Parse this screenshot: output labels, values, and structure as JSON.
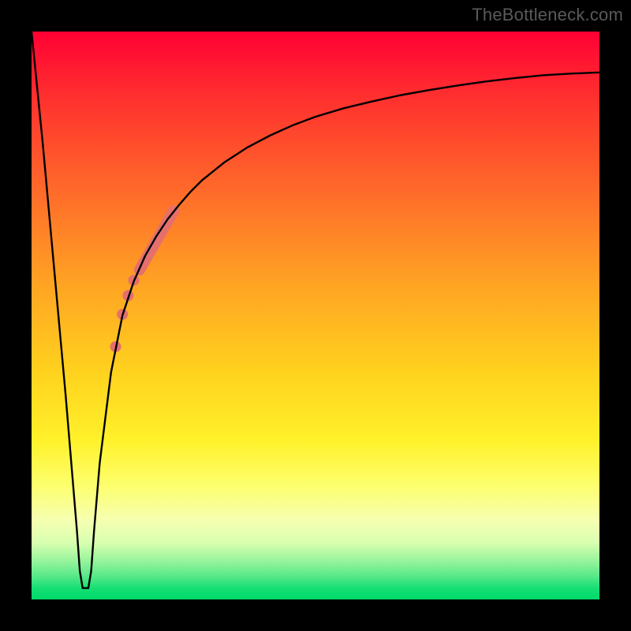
{
  "attribution": "TheBottleneck.com",
  "chart_data": {
    "type": "line",
    "title": "",
    "xlabel": "",
    "ylabel": "",
    "xlim": [
      0,
      100
    ],
    "ylim": [
      0,
      100
    ],
    "grid": false,
    "legend": false,
    "series": [
      {
        "name": "bottleneck-curve",
        "x": [
          0,
          2,
          4,
          6,
          8,
          8.5,
          9,
          9.5,
          10,
          10.5,
          11,
          12,
          14,
          16,
          18,
          20,
          22,
          24,
          26,
          28,
          30,
          34,
          38,
          42,
          46,
          50,
          55,
          60,
          65,
          70,
          75,
          80,
          85,
          90,
          95,
          100
        ],
        "y": [
          100,
          80,
          58,
          36,
          12,
          5,
          2,
          2,
          2,
          5,
          12,
          24,
          40,
          50,
          56,
          60.5,
          64,
          67,
          69.5,
          71.8,
          73.8,
          77,
          79.6,
          81.7,
          83.5,
          85.0,
          86.5,
          87.7,
          88.8,
          89.7,
          90.5,
          91.2,
          91.8,
          92.3,
          92.6,
          92.8
        ],
        "color": "#000000",
        "width": 2.4
      }
    ],
    "markers": [
      {
        "type": "thick-segment",
        "x1": 19,
        "y1": 58,
        "x2": 25,
        "y2": 68.4,
        "color": "#e46f6c",
        "width": 14
      },
      {
        "type": "dot",
        "x": 18.0,
        "y": 56.2,
        "r": 7,
        "color": "#e46f6c"
      },
      {
        "type": "dot",
        "x": 17.0,
        "y": 53.5,
        "r": 7,
        "color": "#e46f6c"
      },
      {
        "type": "dot",
        "x": 16.0,
        "y": 50.2,
        "r": 7,
        "color": "#e46f6c"
      },
      {
        "type": "dot",
        "x": 14.8,
        "y": 44.5,
        "r": 7,
        "color": "#e46f6c"
      }
    ]
  }
}
